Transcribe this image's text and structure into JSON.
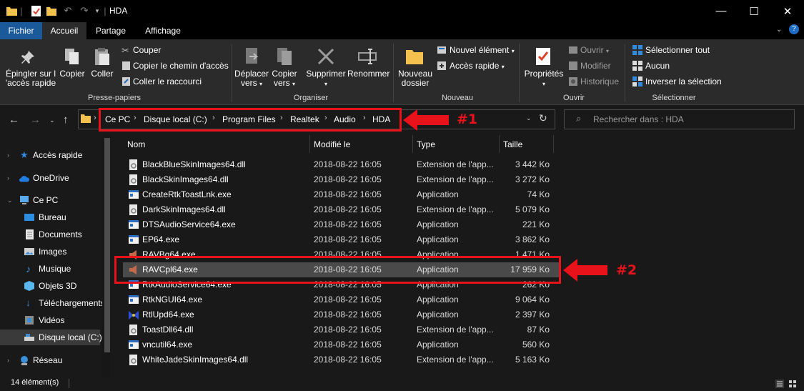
{
  "window": {
    "title": "HDA",
    "minimize": "—",
    "maximize": "☐",
    "close": "✕"
  },
  "ribbon_tabs": [
    "Fichier",
    "Accueil",
    "Partage",
    "Affichage"
  ],
  "ribbon": {
    "presse_papiers": {
      "group_label": "Presse-papiers",
      "pin_line1": "Épingler sur l",
      "pin_line2": "'accès rapide",
      "copy": "Copier",
      "paste": "Coller",
      "cut": "Couper",
      "copy_path": "Copier le chemin d'accès",
      "paste_shortcut": "Coller le raccourci"
    },
    "organiser": {
      "group_label": "Organiser",
      "move_line1": "Déplacer",
      "move_line2": "vers",
      "copyto_line1": "Copier",
      "copyto_line2": "vers",
      "delete": "Supprimer",
      "rename": "Renommer"
    },
    "nouveau": {
      "group_label": "Nouveau",
      "new_folder_line1": "Nouveau",
      "new_folder_line2": "dossier",
      "new_item": "Nouvel élément",
      "quick_access": "Accès rapide"
    },
    "ouvrir": {
      "group_label": "Ouvrir",
      "properties": "Propriétés",
      "open": "Ouvrir",
      "edit": "Modifier",
      "history": "Historique"
    },
    "selectionner": {
      "group_label": "Sélectionner",
      "select_all": "Sélectionner tout",
      "select_none": "Aucun",
      "invert": "Inverser la sélection"
    }
  },
  "address": {
    "breadcrumbs": [
      "Ce PC",
      "Disque local (C:)",
      "Program Files",
      "Realtek",
      "Audio",
      "HDA"
    ],
    "search_placeholder": "Rechercher dans : HDA"
  },
  "sidebar": {
    "items": [
      {
        "label": "Accès rapide",
        "icon": "star-icon"
      },
      {
        "label": "OneDrive",
        "icon": "cloud-icon"
      },
      {
        "label": "Ce PC",
        "icon": "computer-icon"
      },
      {
        "label": "Bureau",
        "icon": "desktop-folder-icon"
      },
      {
        "label": "Documents",
        "icon": "documents-folder-icon"
      },
      {
        "label": "Images",
        "icon": "pictures-folder-icon"
      },
      {
        "label": "Musique",
        "icon": "music-folder-icon"
      },
      {
        "label": "Objets 3D",
        "icon": "3d-objects-icon"
      },
      {
        "label": "Téléchargements",
        "icon": "downloads-folder-icon"
      },
      {
        "label": "Vidéos",
        "icon": "videos-folder-icon"
      },
      {
        "label": "Disque local (C:)",
        "icon": "drive-icon"
      },
      {
        "label": "Réseau",
        "icon": "network-icon"
      }
    ]
  },
  "columns": [
    "Nom",
    "Modifié le",
    "Type",
    "Taille"
  ],
  "files": [
    {
      "name": "BlackBlueSkinImages64.dll",
      "date": "2018-08-22 16:05",
      "type": "Extension de l'app...",
      "size": "3 442 Ko"
    },
    {
      "name": "BlackSkinImages64.dll",
      "date": "2018-08-22 16:05",
      "type": "Extension de l'app...",
      "size": "3 272 Ko"
    },
    {
      "name": "CreateRtkToastLnk.exe",
      "date": "2018-08-22 16:05",
      "type": "Application",
      "size": "74 Ko"
    },
    {
      "name": "DarkSkinImages64.dll",
      "date": "2018-08-22 16:05",
      "type": "Extension de l'app...",
      "size": "5 079 Ko"
    },
    {
      "name": "DTSAudioService64.exe",
      "date": "2018-08-22 16:05",
      "type": "Application",
      "size": "221 Ko"
    },
    {
      "name": "EP64.exe",
      "date": "2018-08-22 16:05",
      "type": "Application",
      "size": "3 862 Ko"
    },
    {
      "name": "RAVBg64.exe",
      "date": "2018-08-22 16:05",
      "type": "Application",
      "size": "1 471 Ko"
    },
    {
      "name": "RAVCpl64.exe",
      "date": "2018-08-22 16:05",
      "type": "Application",
      "size": "17 959 Ko"
    },
    {
      "name": "RtkAudioService64.exe",
      "date": "2018-08-22 16:05",
      "type": "Application",
      "size": "262 Ko"
    },
    {
      "name": "RtkNGUI64.exe",
      "date": "2018-08-22 16:05",
      "type": "Application",
      "size": "9 064 Ko"
    },
    {
      "name": "RtlUpd64.exe",
      "date": "2018-08-22 16:05",
      "type": "Application",
      "size": "2 397 Ko"
    },
    {
      "name": "ToastDll64.dll",
      "date": "2018-08-22 16:05",
      "type": "Extension de l'app...",
      "size": "87 Ko"
    },
    {
      "name": "vncutil64.exe",
      "date": "2018-08-22 16:05",
      "type": "Application",
      "size": "560 Ko"
    },
    {
      "name": "WhiteJadeSkinImages64.dll",
      "date": "2018-08-22 16:05",
      "type": "Extension de l'app...",
      "size": "5 163 Ko"
    }
  ],
  "status": {
    "count": "14 élément(s)"
  },
  "annotations": {
    "label1": "#1",
    "label2": "#2",
    "color": "#e8121a"
  }
}
